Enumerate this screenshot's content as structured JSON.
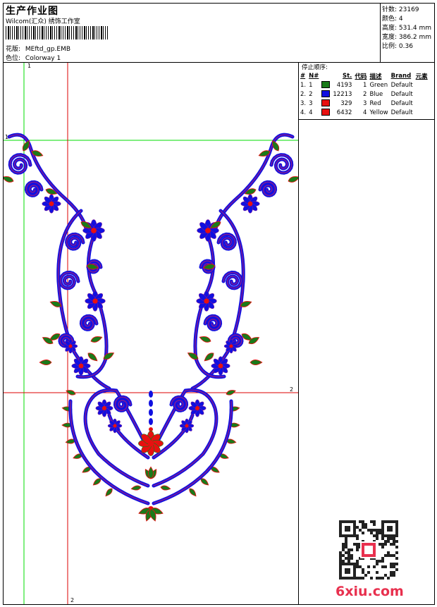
{
  "header": {
    "title": "生产作业图",
    "company": "Wilcom(汇众) 绣饰工作室",
    "design_label": "花版:",
    "design_value": "MEftd_gp.EMB",
    "colorway_label": "色位:",
    "colorway_value": "Colorway 1"
  },
  "stats": {
    "stitches": "针数: 23169",
    "colors": "颜色: 4",
    "height": "高度: 531.4 mm",
    "width": "宽度: 386.2 mm",
    "scale": "比例: 0.36"
  },
  "sequence": {
    "title": "停止顺序:",
    "headers": [
      "#",
      "N#",
      "St.",
      "代码",
      "描述",
      "Brand",
      "元素"
    ],
    "rows": [
      {
        "idx": "1.",
        "n": "1",
        "color": "#1a7a1a",
        "st": "4193",
        "code": "1",
        "desc": "Green",
        "brand": "Default"
      },
      {
        "idx": "2.",
        "n": "2",
        "color": "#1010e0",
        "st": "12213",
        "code": "2",
        "desc": "Blue",
        "brand": "Default"
      },
      {
        "idx": "3.",
        "n": "3",
        "color": "#e81010",
        "st": "329",
        "code": "3",
        "desc": "Red",
        "brand": "Default"
      },
      {
        "idx": "4.",
        "n": "4",
        "color": "#e81010",
        "st": "6432",
        "code": "4",
        "desc": "Yellow",
        "brand": "Default"
      }
    ]
  },
  "markers": {
    "v1": "1",
    "h1": "1",
    "h2": "2",
    "v2": "2"
  },
  "watermark": "6xiu.com",
  "colors": {
    "green": "#1a7a1a",
    "blue": "#1010e0",
    "purple": "#7a1a9a",
    "red": "#e81010",
    "guide_green": "#00dd00",
    "guide_red": "#dd0000"
  }
}
